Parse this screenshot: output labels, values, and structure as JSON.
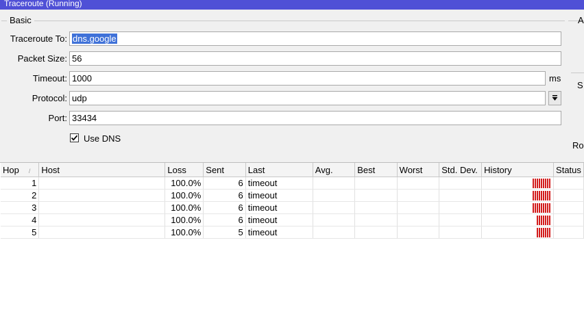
{
  "window": {
    "title": "Traceroute (Running)"
  },
  "basic": {
    "group_label": "Basic",
    "traceroute_to": {
      "label": "Traceroute To:",
      "value": "dns.google"
    },
    "packet_size": {
      "label": "Packet Size:",
      "value": "56"
    },
    "timeout": {
      "label": "Timeout:",
      "value": "1000",
      "unit": "ms"
    },
    "protocol": {
      "label": "Protocol:",
      "value": "udp"
    },
    "port": {
      "label": "Port:",
      "value": "33434"
    },
    "use_dns": {
      "label": "Use DNS",
      "checked": true
    }
  },
  "right_panel": {
    "group_label_partial": "A",
    "label_s": "S",
    "label_ro": "Ro"
  },
  "table": {
    "columns": [
      "Hop",
      "Host",
      "Loss",
      "Sent",
      "Last",
      "Avg.",
      "Best",
      "Worst",
      "Std. Dev.",
      "History",
      "Status"
    ],
    "rows": [
      {
        "hop": "1",
        "host": "",
        "loss": "100.0%",
        "sent": "6",
        "last": "timeout",
        "avg": "",
        "best": "",
        "worst": "",
        "stddev": "",
        "history_bars": 9,
        "status": ""
      },
      {
        "hop": "2",
        "host": "",
        "loss": "100.0%",
        "sent": "6",
        "last": "timeout",
        "avg": "",
        "best": "",
        "worst": "",
        "stddev": "",
        "history_bars": 9,
        "status": ""
      },
      {
        "hop": "3",
        "host": "",
        "loss": "100.0%",
        "sent": "6",
        "last": "timeout",
        "avg": "",
        "best": "",
        "worst": "",
        "stddev": "",
        "history_bars": 9,
        "status": ""
      },
      {
        "hop": "4",
        "host": "",
        "loss": "100.0%",
        "sent": "6",
        "last": "timeout",
        "avg": "",
        "best": "",
        "worst": "",
        "stddev": "",
        "history_bars": 7,
        "status": ""
      },
      {
        "hop": "5",
        "host": "",
        "loss": "100.0%",
        "sent": "5",
        "last": "timeout",
        "avg": "",
        "best": "",
        "worst": "",
        "stddev": "",
        "history_bars": 7,
        "status": ""
      }
    ]
  },
  "colors": {
    "titlebar": "#4f50d6",
    "history_bar": "#d21a1a",
    "selection": "#3f71d8"
  }
}
